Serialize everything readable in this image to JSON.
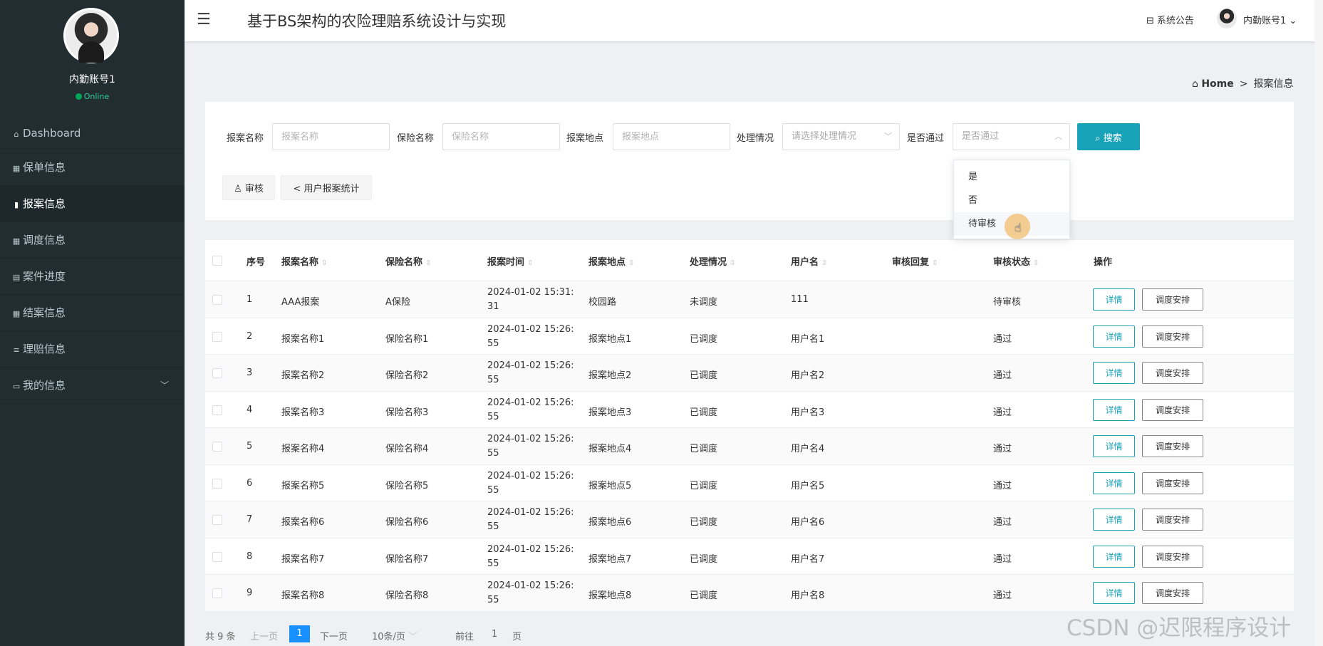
{
  "app": {
    "title": "基于BS架构的农险理赔系统设计与实现"
  },
  "user": {
    "name": "内勤账号1",
    "status": "Online"
  },
  "header": {
    "notice_label": "系统公告",
    "user_label": "内勤账号1"
  },
  "sidebar": {
    "items": [
      {
        "label": "Dashboard",
        "icon": "home-icon"
      },
      {
        "label": "保单信息",
        "icon": "grid-icon"
      },
      {
        "label": "报案信息",
        "icon": "lock-icon"
      },
      {
        "label": "调度信息",
        "icon": "grid-icon"
      },
      {
        "label": "案件进度",
        "icon": "doc-icon"
      },
      {
        "label": "结案信息",
        "icon": "grid-icon"
      },
      {
        "label": "理赔信息",
        "icon": "list-icon"
      },
      {
        "label": "我的信息",
        "icon": "card-icon"
      }
    ]
  },
  "breadcrumb": {
    "home": "Home",
    "current": "报案信息"
  },
  "search": {
    "fields": [
      {
        "label": "报案名称",
        "placeholder": "报案名称"
      },
      {
        "label": "保险名称",
        "placeholder": "保险名称"
      },
      {
        "label": "报案地点",
        "placeholder": "报案地点"
      },
      {
        "label": "处理情况",
        "placeholder": "请选择处理情况"
      },
      {
        "label": "是否通过",
        "placeholder": "是否通过"
      }
    ],
    "button": "搜索"
  },
  "toolbar": {
    "audit": "审核",
    "stats": "用户报案统计"
  },
  "dropdown": {
    "options": [
      "是",
      "否",
      "待审核"
    ]
  },
  "table": {
    "headers": [
      "序号",
      "报案名称",
      "保险名称",
      "报案时间",
      "报案地点",
      "处理情况",
      "用户名",
      "审核回复",
      "审核状态",
      "操作"
    ],
    "rows": [
      {
        "no": "1",
        "name": "AAA报案",
        "insurance": "A保险",
        "time": "2024-01-02 15:31:31",
        "place": "校园路",
        "handling": "未调度",
        "user": "111",
        "reply": "",
        "status": "待审核"
      },
      {
        "no": "2",
        "name": "报案名称1",
        "insurance": "保险名称1",
        "time": "2024-01-02 15:26:55",
        "place": "报案地点1",
        "handling": "已调度",
        "user": "用户名1",
        "reply": "",
        "status": "通过"
      },
      {
        "no": "3",
        "name": "报案名称2",
        "insurance": "保险名称2",
        "time": "2024-01-02 15:26:55",
        "place": "报案地点2",
        "handling": "已调度",
        "user": "用户名2",
        "reply": "",
        "status": "通过"
      },
      {
        "no": "4",
        "name": "报案名称3",
        "insurance": "保险名称3",
        "time": "2024-01-02 15:26:55",
        "place": "报案地点3",
        "handling": "已调度",
        "user": "用户名3",
        "reply": "",
        "status": "通过"
      },
      {
        "no": "5",
        "name": "报案名称4",
        "insurance": "保险名称4",
        "time": "2024-01-02 15:26:55",
        "place": "报案地点4",
        "handling": "已调度",
        "user": "用户名4",
        "reply": "",
        "status": "通过"
      },
      {
        "no": "6",
        "name": "报案名称5",
        "insurance": "保险名称5",
        "time": "2024-01-02 15:26:55",
        "place": "报案地点5",
        "handling": "已调度",
        "user": "用户名5",
        "reply": "",
        "status": "通过"
      },
      {
        "no": "7",
        "name": "报案名称6",
        "insurance": "保险名称6",
        "time": "2024-01-02 15:26:55",
        "place": "报案地点6",
        "handling": "已调度",
        "user": "用户名6",
        "reply": "",
        "status": "通过"
      },
      {
        "no": "8",
        "name": "报案名称7",
        "insurance": "保险名称7",
        "time": "2024-01-02 15:26:55",
        "place": "报案地点7",
        "handling": "已调度",
        "user": "用户名7",
        "reply": "",
        "status": "通过"
      },
      {
        "no": "9",
        "name": "报案名称8",
        "insurance": "保险名称8",
        "time": "2024-01-02 15:26:55",
        "place": "报案地点8",
        "handling": "已调度",
        "user": "用户名8",
        "reply": "",
        "status": "通过"
      }
    ],
    "actions": {
      "detail": "详情",
      "dispatch": "调度安排"
    }
  },
  "pagination": {
    "total": "共 9 条",
    "prev": "上一页",
    "current": "1",
    "next": "下一页",
    "page_size": "10条/页",
    "goto_label": "前往",
    "goto_value": "1",
    "page_suffix": "页"
  },
  "watermark": "CSDN @迟限程序设计",
  "colors": {
    "sidebar_bg": "#222d32",
    "accent": "#17a2b8",
    "page_active": "#1890ff"
  }
}
